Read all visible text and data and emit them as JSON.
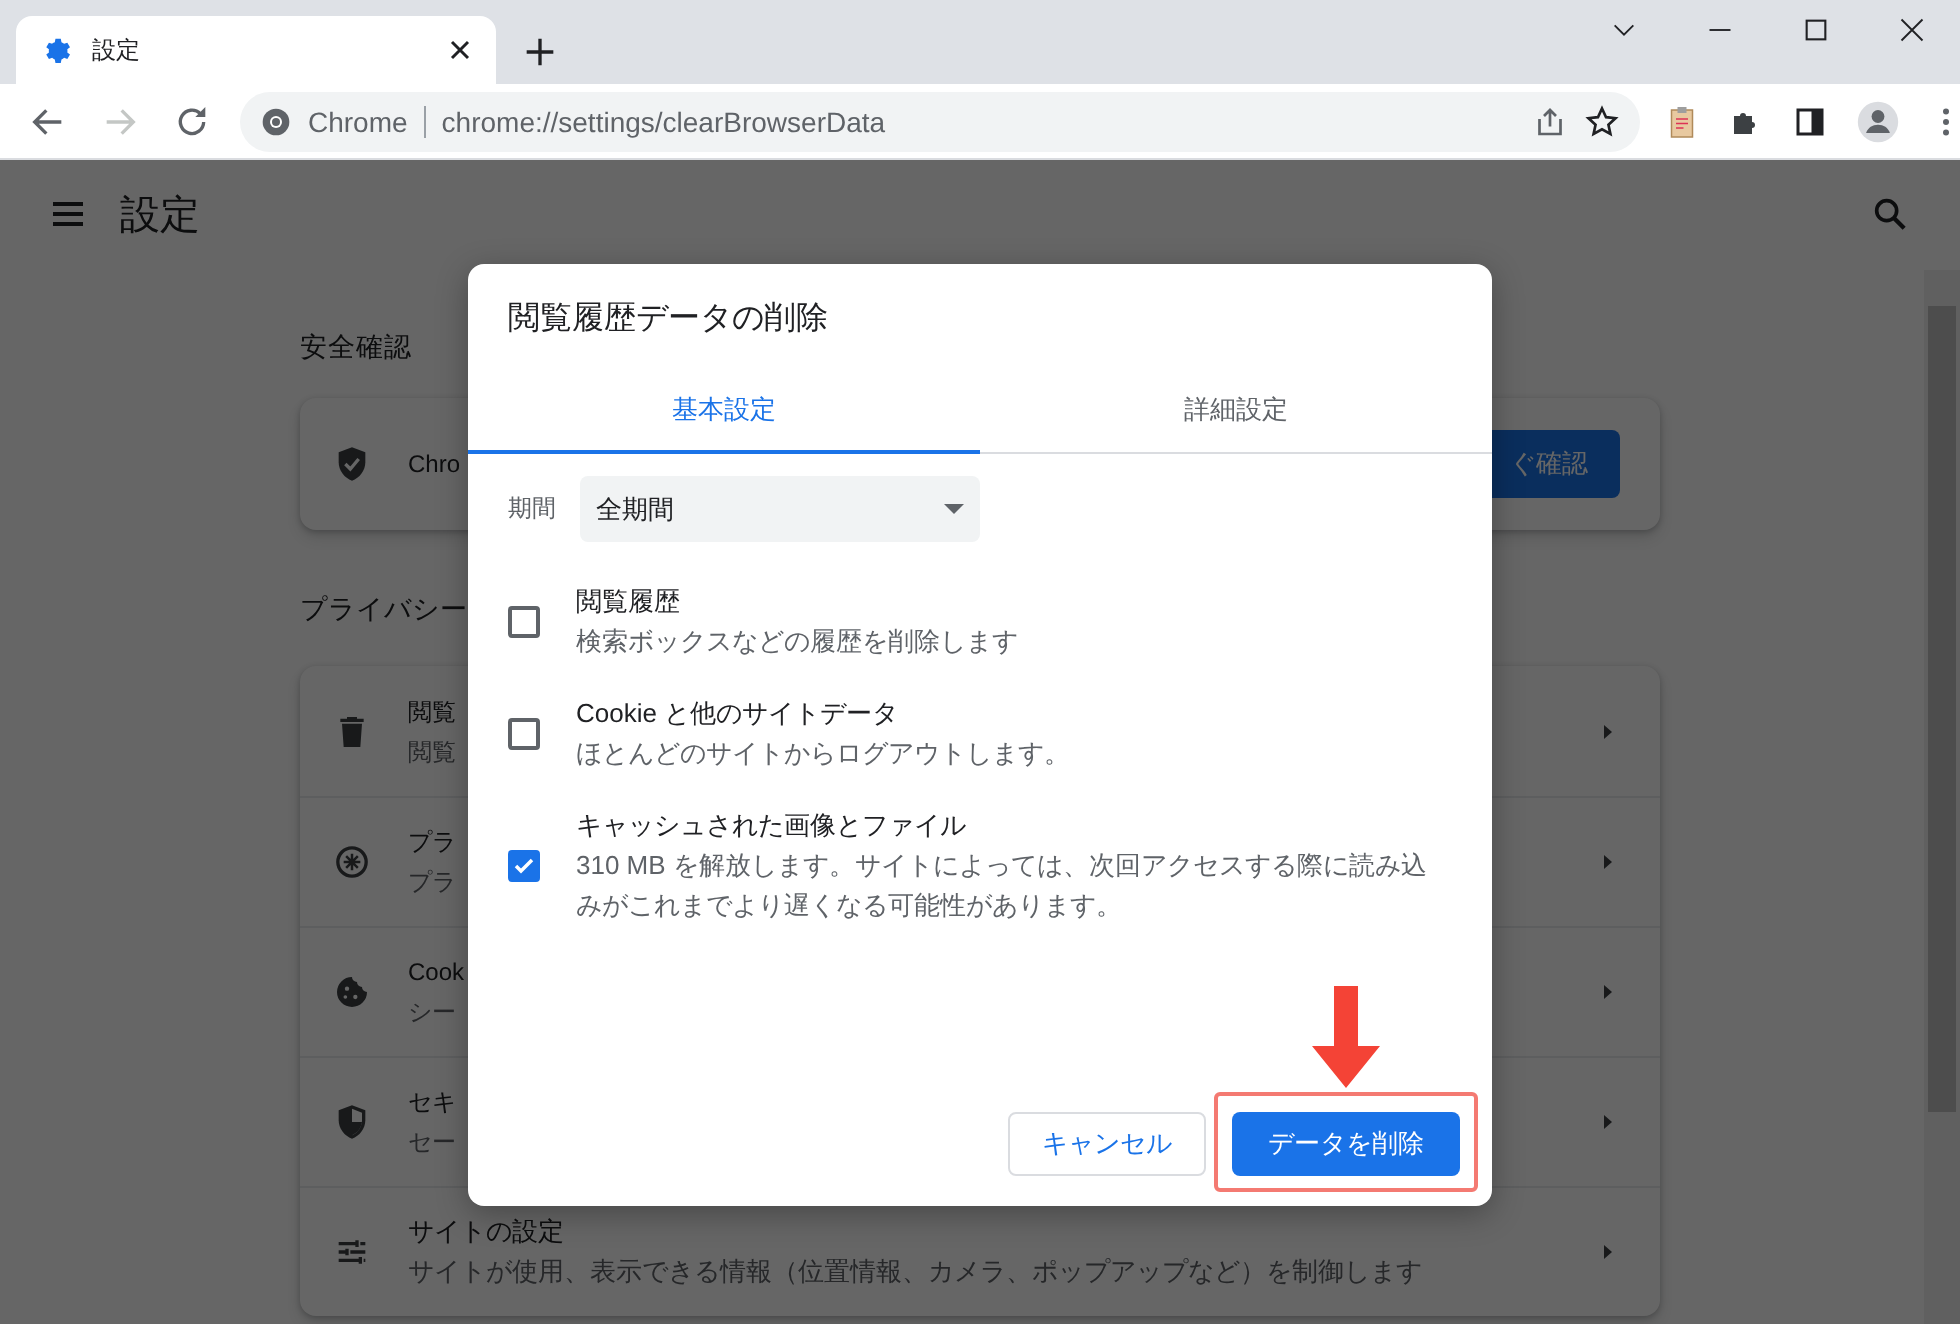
{
  "browser": {
    "tab_title": "設定",
    "forward_disabled": true,
    "omnibox_label": "Chrome",
    "url": "chrome://settings/clearBrowserData"
  },
  "settings_page": {
    "title": "設定",
    "safety_check": {
      "heading": "安全確認",
      "text": "Chro",
      "button": "ぐ確認"
    },
    "privacy": {
      "heading": "プライバシー",
      "items": [
        {
          "title": "閲覧",
          "subtitle": "閲覧"
        },
        {
          "title": "プラ",
          "subtitle": "プラ"
        },
        {
          "title": "Cook",
          "subtitle": "シー"
        },
        {
          "title": "セキ",
          "subtitle": "セー"
        },
        {
          "title": "サイトの設定",
          "subtitle": "サイトが使用、表示できる情報（位置情報、カメラ、ポップアップなど）を制御します"
        }
      ]
    }
  },
  "dialog": {
    "title": "閲覧履歴データの削除",
    "tabs": [
      {
        "label": "基本設定",
        "selected": true
      },
      {
        "label": "詳細設定",
        "selected": false
      }
    ],
    "time_range": {
      "label": "期間",
      "value": "全期間"
    },
    "options": [
      {
        "title": "閲覧履歴",
        "description": "検索ボックスなどの履歴を削除します",
        "checked": false
      },
      {
        "title": "Cookie と他のサイトデータ",
        "description": "ほとんどのサイトからログアウトします。",
        "checked": false
      },
      {
        "title": "キャッシュされた画像とファイル",
        "description": "310 MB を解放します。サイトによっては、次回アクセスする際に読み込みがこれまでより遅くなる可能性があります。",
        "checked": true
      }
    ],
    "buttons": [
      {
        "label": "キャンセル",
        "kind": "secondary",
        "highlighted": false
      },
      {
        "label": "データを削除",
        "kind": "primary",
        "highlighted": true
      }
    ]
  }
}
